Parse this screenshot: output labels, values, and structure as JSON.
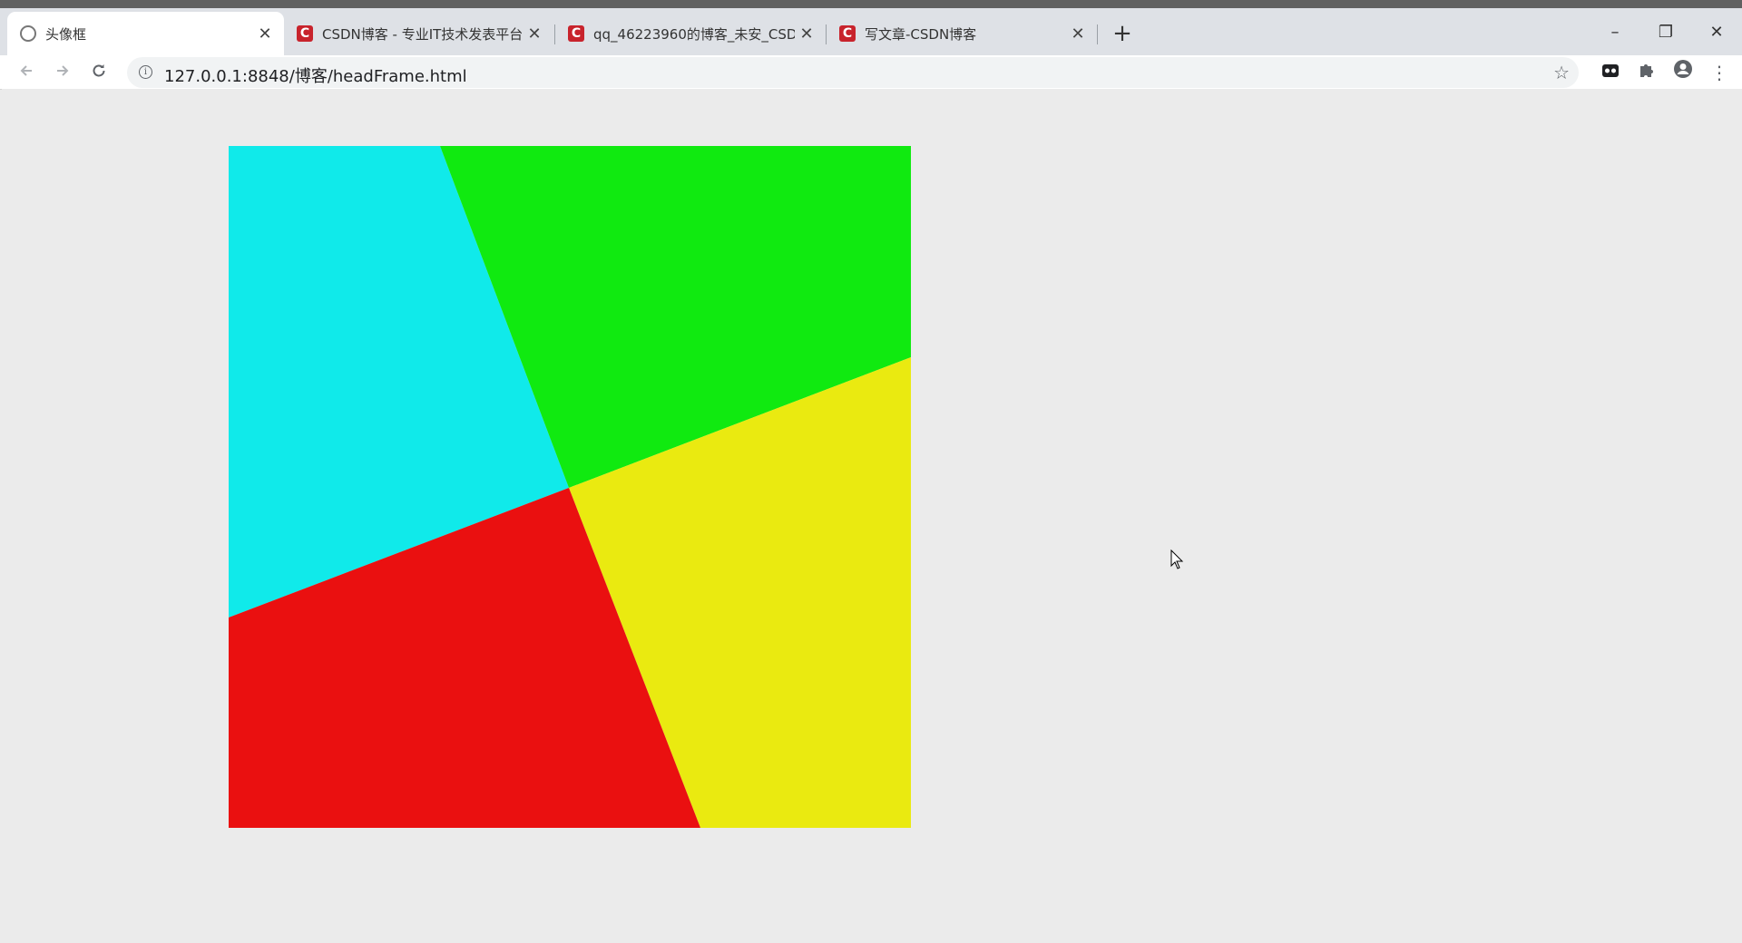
{
  "browser": {
    "tabs": [
      {
        "title": "头像框",
        "active": true,
        "favicon": "loading-icon"
      },
      {
        "title": "CSDN博客 - 专业IT技术发表平台",
        "active": false,
        "favicon": "csdn-icon"
      },
      {
        "title": "qq_46223960的博客_未安_CSDN",
        "active": false,
        "favicon": "csdn-icon"
      },
      {
        "title": "写文章-CSDN博客",
        "active": false,
        "favicon": "csdn-icon"
      }
    ],
    "new_tab": "+",
    "favicon_letter": "C",
    "close_glyph": "✕",
    "url": "127.0.0.1:8848/博客/headFrame.html",
    "window_controls": {
      "minimize": "–",
      "restore": "❐",
      "close": "✕"
    }
  },
  "colors": {
    "cyan": "#10eaea",
    "green": "#10ea10",
    "yellow": "#eaea10",
    "red": "#ea1010"
  }
}
